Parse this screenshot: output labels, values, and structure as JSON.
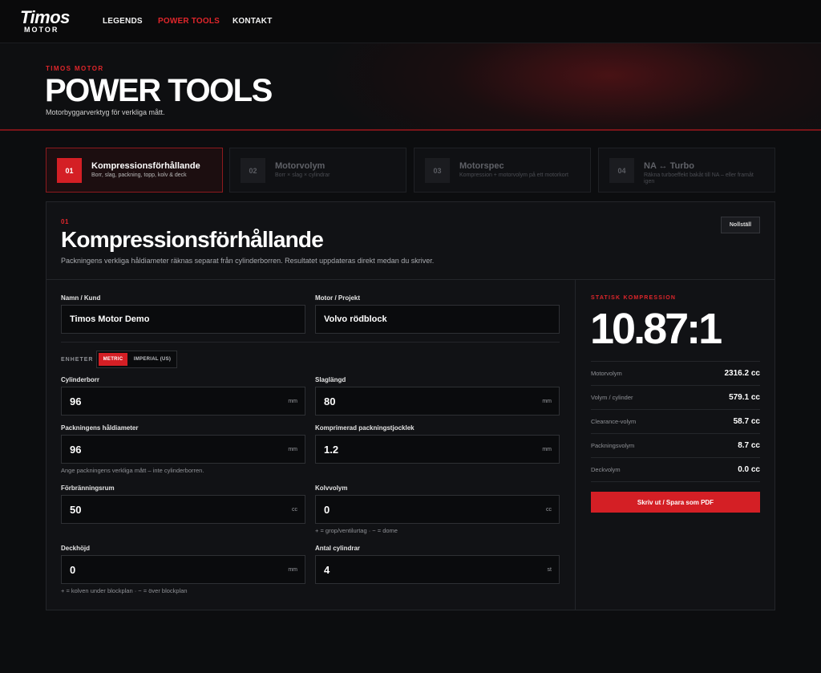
{
  "nav": {
    "logo_main": "Timos",
    "logo_sub": "MOTOR",
    "links": [
      "LEGENDS",
      "POWER TOOLS",
      "KONTAKT"
    ]
  },
  "hero": {
    "eyebrow": "TIMOS MOTOR",
    "title": "POWER TOOLS",
    "subtitle": "Motorbyggarverktyg för verkliga mått."
  },
  "tabs": [
    {
      "num": "01",
      "title": "Kompressionsförhållande",
      "desc": "Borr, slag, packning, topp, kolv & deck"
    },
    {
      "num": "02",
      "title": "Motorvolym",
      "desc": "Borr × slag × cylindrar"
    },
    {
      "num": "03",
      "title": "Motorspec",
      "desc": "Kompression + motorvolym på ett motorkort"
    },
    {
      "num": "04",
      "title": "NA ↔ Turbo",
      "desc": "Räkna turboeffekt bakåt till NA – eller framåt igen"
    }
  ],
  "panel": {
    "num": "01",
    "title": "Kompressionsförhållande",
    "desc": "Packningens verkliga håldiameter räknas separat från cylinderborren. Resultatet uppdateras direkt medan du skriver.",
    "reset_label": "Nollställ"
  },
  "form": {
    "name": {
      "label": "Namn / Kund",
      "value": "Timos Motor Demo"
    },
    "project": {
      "label": "Motor / Projekt",
      "value": "Volvo rödblock"
    },
    "units": {
      "label": "ENHETER",
      "metric": "METRIC",
      "imperial": "IMPERIAL (US)"
    },
    "bore": {
      "label": "Cylinderborr",
      "value": "96",
      "unit": "mm"
    },
    "stroke": {
      "label": "Slaglängd",
      "value": "80",
      "unit": "mm"
    },
    "gasket_bore": {
      "label": "Packningens håldiameter",
      "value": "96",
      "unit": "mm",
      "hint": "Ange packningens verkliga mått – inte cylinderborren."
    },
    "gasket_thickness": {
      "label": "Komprimerad packningstjocklek",
      "value": "1.2",
      "unit": "mm"
    },
    "chamber": {
      "label": "Förbränningsrum",
      "value": "50",
      "unit": "cc"
    },
    "piston": {
      "label": "Kolvvolym",
      "value": "0",
      "unit": "cc",
      "hint": "+ = grop/ventilurtag · − = dome"
    },
    "deck": {
      "label": "Deckhöjd",
      "value": "0",
      "unit": "mm",
      "hint": "+ = kolven under blockplan · − = över blockplan"
    },
    "cylinders": {
      "label": "Antal cylindrar",
      "value": "4",
      "unit": "st"
    }
  },
  "result": {
    "eyebrow": "STATISK KOMPRESSION",
    "value": "10.87:1",
    "rows": [
      {
        "name": "Motorvolym",
        "value": "2316.2 cc"
      },
      {
        "name": "Volym / cylinder",
        "value": "579.1 cc"
      },
      {
        "name": "Clearance-volym",
        "value": "58.7 cc"
      },
      {
        "name": "Packningsvolym",
        "value": "8.7 cc"
      },
      {
        "name": "Deckvolym",
        "value": "0.0 cc"
      }
    ],
    "print_label": "Skriv ut / Spara som PDF"
  },
  "colors": {
    "accent": "#d41f25",
    "background": "#0c0d0f",
    "panel": "#111215"
  }
}
